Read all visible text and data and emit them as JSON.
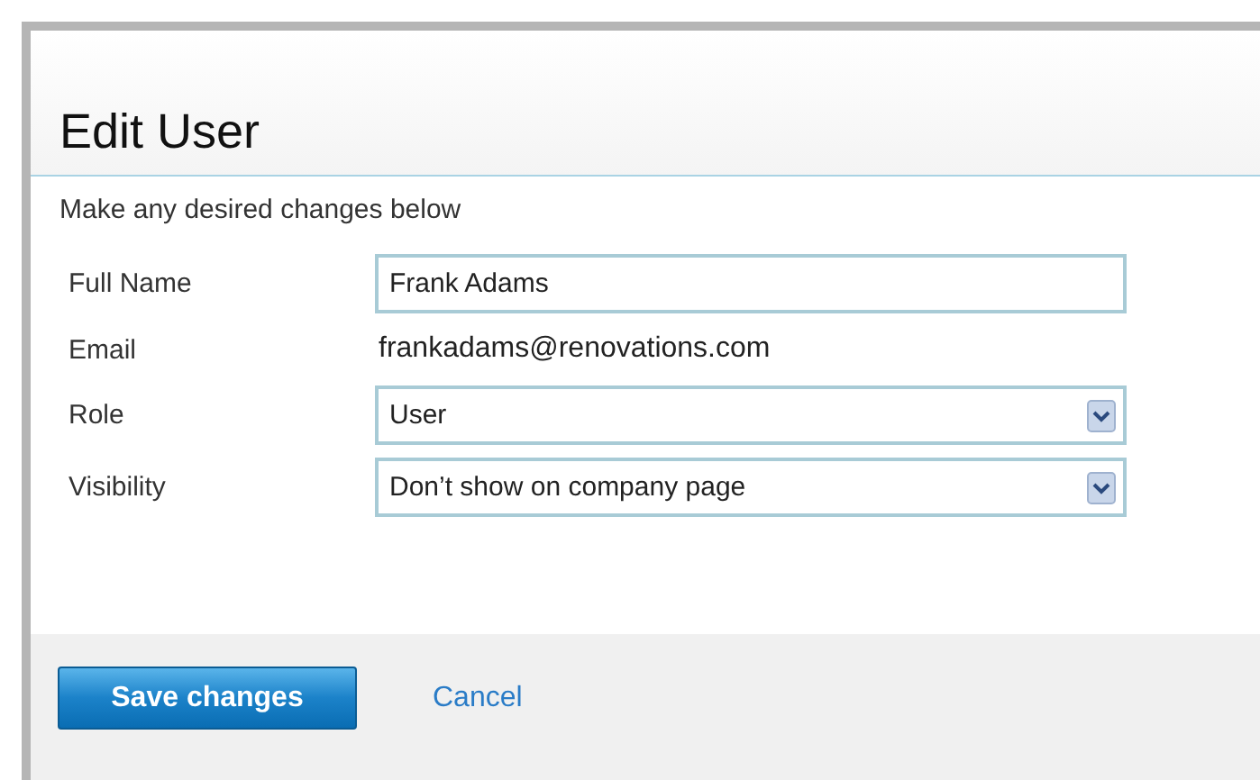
{
  "dialog": {
    "title": "Edit User",
    "subtitle": "Make any desired changes below"
  },
  "fields": [
    {
      "label": "Full Name",
      "kind": "text",
      "value": "Frank Adams"
    },
    {
      "label": "Email",
      "kind": "static",
      "value": "frankadams@renovations.com"
    },
    {
      "label": "Role",
      "kind": "select",
      "value": "User"
    },
    {
      "label": "Visibility",
      "kind": "select",
      "value": "Don’t show on company page"
    }
  ],
  "buttons": [
    {
      "label": "Save changes",
      "kind": "primary"
    },
    {
      "label": "Cancel",
      "kind": "link"
    }
  ]
}
